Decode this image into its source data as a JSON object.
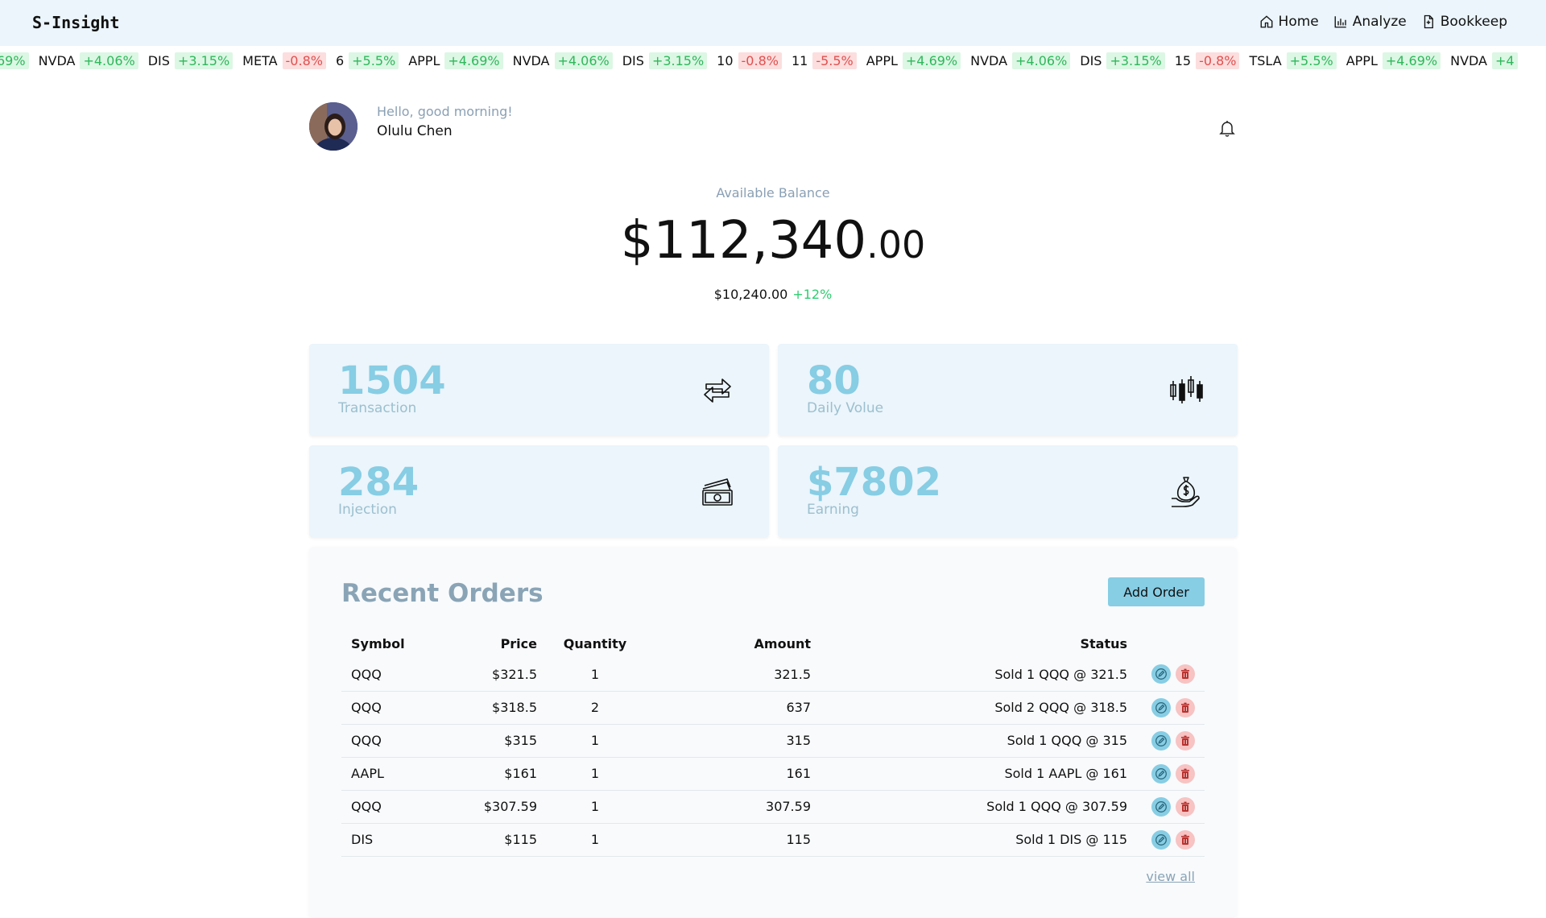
{
  "header": {
    "brand": "S-Insight",
    "nav": [
      {
        "label": "Home",
        "icon": "home-icon"
      },
      {
        "label": "Analyze",
        "icon": "bar-chart-icon"
      },
      {
        "label": "Bookkeep",
        "icon": "document-icon"
      }
    ]
  },
  "ticker": [
    {
      "symbol": "",
      "change": "69%",
      "dir": "up"
    },
    {
      "symbol": "NVDA",
      "change": "+4.06%",
      "dir": "up"
    },
    {
      "symbol": "DIS",
      "change": "+3.15%",
      "dir": "up"
    },
    {
      "symbol": "META",
      "change": "-0.8%",
      "dir": "down"
    },
    {
      "symbol": "6",
      "change": "+5.5%",
      "dir": "up"
    },
    {
      "symbol": "APPL",
      "change": "+4.69%",
      "dir": "up"
    },
    {
      "symbol": "NVDA",
      "change": "+4.06%",
      "dir": "up"
    },
    {
      "symbol": "DIS",
      "change": "+3.15%",
      "dir": "up"
    },
    {
      "symbol": "10",
      "change": "-0.8%",
      "dir": "down"
    },
    {
      "symbol": "11",
      "change": "-5.5%",
      "dir": "down"
    },
    {
      "symbol": "APPL",
      "change": "+4.69%",
      "dir": "up"
    },
    {
      "symbol": "NVDA",
      "change": "+4.06%",
      "dir": "up"
    },
    {
      "symbol": "DIS",
      "change": "+3.15%",
      "dir": "up"
    },
    {
      "symbol": "15",
      "change": "-0.8%",
      "dir": "down"
    },
    {
      "symbol": "TSLA",
      "change": "+5.5%",
      "dir": "up"
    },
    {
      "symbol": "APPL",
      "change": "+4.69%",
      "dir": "up"
    },
    {
      "symbol": "NVDA",
      "change": "+4",
      "dir": "up"
    }
  ],
  "user": {
    "greeting": "Hello, good morning!",
    "name": "Olulu Chen"
  },
  "balance": {
    "label": "Available Balance",
    "main": "$112,340",
    "cents": ".00",
    "sub_amount": "$10,240.00",
    "sub_change": "+12%"
  },
  "stats": [
    {
      "value": "1504",
      "label": "Transaction",
      "icon": "exchange-arrows-icon"
    },
    {
      "value": "80",
      "label": "Daily Volue",
      "icon": "candlestick-icon"
    },
    {
      "value": "284",
      "label": "Injection",
      "icon": "cash-icon"
    },
    {
      "value": "$7802",
      "label": "Earning",
      "icon": "money-bag-hand-icon"
    }
  ],
  "orders": {
    "title": "Recent Orders",
    "add_label": "Add Order",
    "columns": {
      "symbol": "Symbol",
      "price": "Price",
      "quantity": "Quantity",
      "amount": "Amount",
      "status": "Status"
    },
    "rows": [
      {
        "symbol": "QQQ",
        "price": "$321.5",
        "quantity": "1",
        "amount": "321.5",
        "status": "Sold 1 QQQ @ 321.5"
      },
      {
        "symbol": "QQQ",
        "price": "$318.5",
        "quantity": "2",
        "amount": "637",
        "status": "Sold 2 QQQ @ 318.5"
      },
      {
        "symbol": "QQQ",
        "price": "$315",
        "quantity": "1",
        "amount": "315",
        "status": "Sold 1 QQQ @ 315"
      },
      {
        "symbol": "AAPL",
        "price": "$161",
        "quantity": "1",
        "amount": "161",
        "status": "Sold 1 AAPL @ 161"
      },
      {
        "symbol": "QQQ",
        "price": "$307.59",
        "quantity": "1",
        "amount": "307.59",
        "status": "Sold 1 QQQ @ 307.59"
      },
      {
        "symbol": "DIS",
        "price": "$115",
        "quantity": "1",
        "amount": "115",
        "status": "Sold 1 DIS @ 115"
      }
    ],
    "view_all": "view all"
  },
  "colors": {
    "header_bg": "#ebf5fb",
    "accent": "#87cde4",
    "up": "#2fb75b",
    "down": "#e0504f"
  }
}
